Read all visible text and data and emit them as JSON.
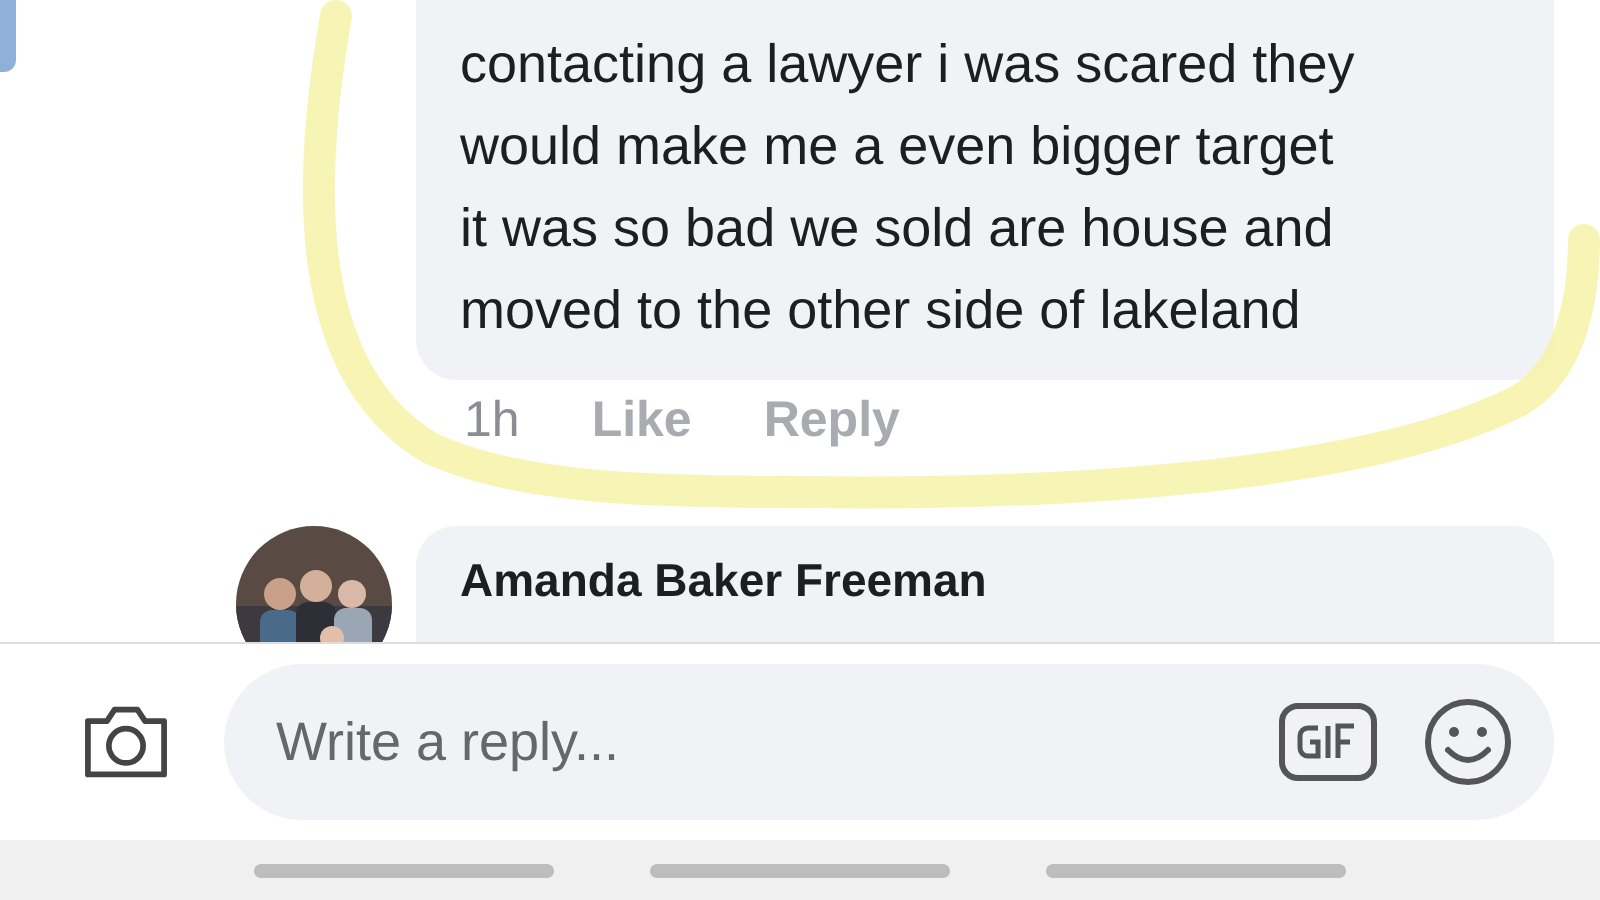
{
  "comments": [
    {
      "text": "contacting a lawyer i was scared they\nwould make me a even bigger target\nit was so bad we sold are house and\nmoved to the other side of lakeland",
      "time": "1h",
      "actions": [
        "Like",
        "Reply"
      ]
    },
    {
      "author": "Amanda Baker Freeman"
    }
  ],
  "composer": {
    "placeholder": "Write a reply..."
  }
}
